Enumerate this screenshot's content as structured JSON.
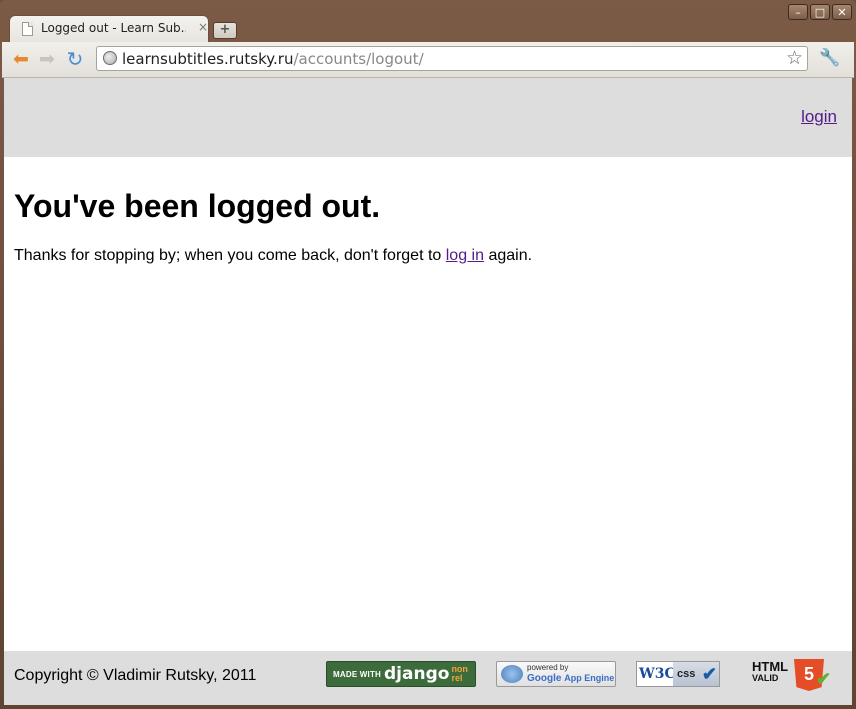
{
  "browser": {
    "tab_title": "Logged out - Learn Sub...",
    "tab_close": "×",
    "new_tab": "+",
    "url_host": "learnsubtitles.rutsky.ru",
    "url_path": "/accounts/logout/",
    "window_controls": [
      "minimize",
      "maximize",
      "close"
    ]
  },
  "header": {
    "login_label": "login"
  },
  "main": {
    "heading": "You've been logged out.",
    "message_before": "Thanks for stopping by; when you come back, don't forget to ",
    "message_link": "log in",
    "message_after": " again."
  },
  "footer": {
    "copyright": "Copyright © Vladimir Rutsky, 2011",
    "badges": {
      "django_small": "MADE WITH",
      "django_big": "django",
      "django_nonrel_1": "non",
      "django_nonrel_2": "rel",
      "gae_powered": "powered by",
      "gae_google": "Google",
      "gae_app": "App Engine",
      "w3c_left": "W3C",
      "w3c_right": "css",
      "html5_title": "HTML",
      "html5_sub": "VALID",
      "html5_num": "5"
    }
  },
  "colors": {
    "frame": "#6e4f3e",
    "header_bg": "#dddddd",
    "link_visited": "#551a8b"
  }
}
